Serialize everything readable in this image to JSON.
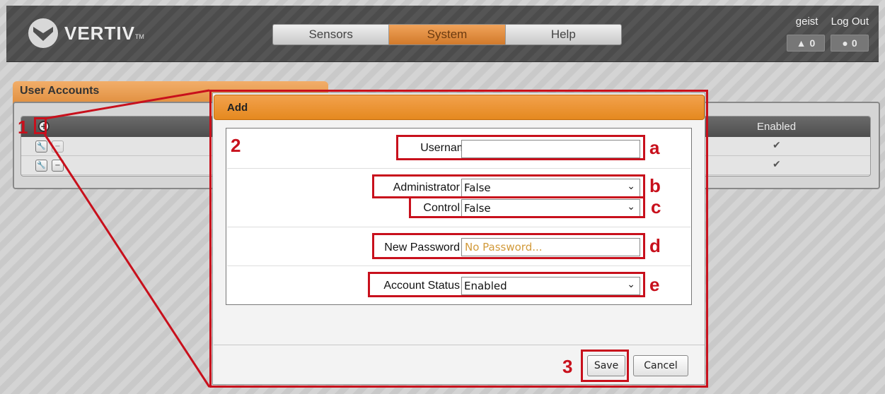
{
  "header": {
    "brand": "VERTIV",
    "brand_tm": "TM",
    "nav_tabs": [
      {
        "label": "Sensors",
        "active": false
      },
      {
        "label": "System",
        "active": true
      },
      {
        "label": "Help",
        "active": false
      }
    ],
    "user": "geist",
    "logout_label": "Log Out",
    "alarm_count": "0",
    "warning_count": "0"
  },
  "user_accounts": {
    "title": "User Accounts",
    "enabled_header": "Enabled",
    "rows": [
      {
        "enabled_mark": "✔"
      },
      {
        "enabled_mark": "✔"
      }
    ]
  },
  "modal": {
    "title": "Add",
    "fields": {
      "username_label": "Username",
      "username_value": "",
      "administrator_label": "Administrator",
      "administrator_value": "False",
      "control_label": "Control",
      "control_value": "False",
      "new_password_label": "New Password",
      "new_password_placeholder": "No Password...",
      "account_status_label": "Account Status",
      "account_status_value": "Enabled"
    },
    "save_label": "Save",
    "cancel_label": "Cancel"
  },
  "annotations": {
    "step1": "1",
    "step2": "2",
    "step3": "3",
    "a": "a",
    "b": "b",
    "c": "c",
    "d": "d",
    "e": "e"
  },
  "colors": {
    "accent": "#e5891f",
    "annotation_red": "#c8101c"
  }
}
